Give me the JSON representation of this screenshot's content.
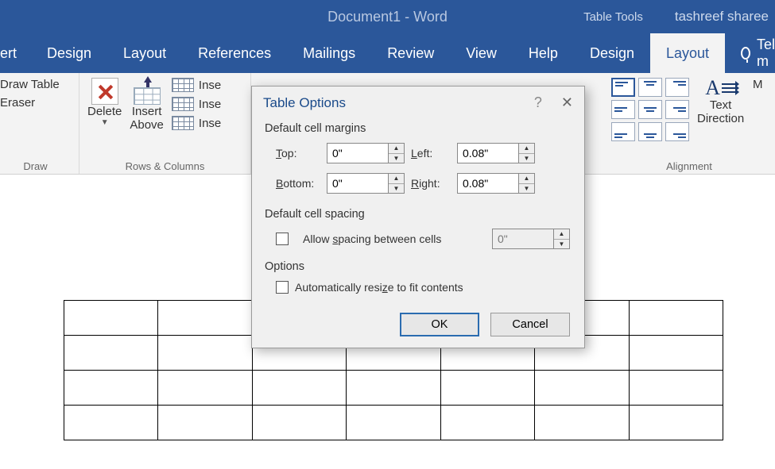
{
  "titlebar": {
    "document_title": "Document1  -  Word",
    "context_tab": "Table Tools",
    "username": "tashreef sharee"
  },
  "tabs": {
    "items": [
      "ert",
      "Design",
      "Layout",
      "References",
      "Mailings",
      "Review",
      "View",
      "Help",
      "Design",
      "Layout"
    ],
    "tell_me": "Tell m",
    "active_index": 9
  },
  "ribbon": {
    "draw": {
      "draw_table": "Draw Table",
      "eraser": "Eraser",
      "group_label": "Draw"
    },
    "rows_cols": {
      "delete": "Delete",
      "insert_above_line1": "Insert",
      "insert_above_line2": "Above",
      "ins1": "Inse",
      "ins2": "Inse",
      "ins3": "Inse",
      "group_label": "Rows & Columns"
    },
    "alignment": {
      "text_direction_line1": "Text",
      "text_direction_line2": "Direction",
      "margins_partial": "M",
      "group_label": "Alignment"
    }
  },
  "dialog": {
    "title": "Table Options",
    "section_margins": "Default cell margins",
    "labels": {
      "top": "Top:",
      "bottom": "Bottom:",
      "left": "Left:",
      "right": "Right:"
    },
    "values": {
      "top": "0\"",
      "bottom": "0\"",
      "left": "0.08\"",
      "right": "0.08\""
    },
    "section_spacing": "Default cell spacing",
    "allow_spacing": "Allow spacing between cells",
    "spacing_value": "0\"",
    "section_options": "Options",
    "auto_resize": "Automatically resize to fit contents",
    "ok": "OK",
    "cancel": "Cancel"
  }
}
